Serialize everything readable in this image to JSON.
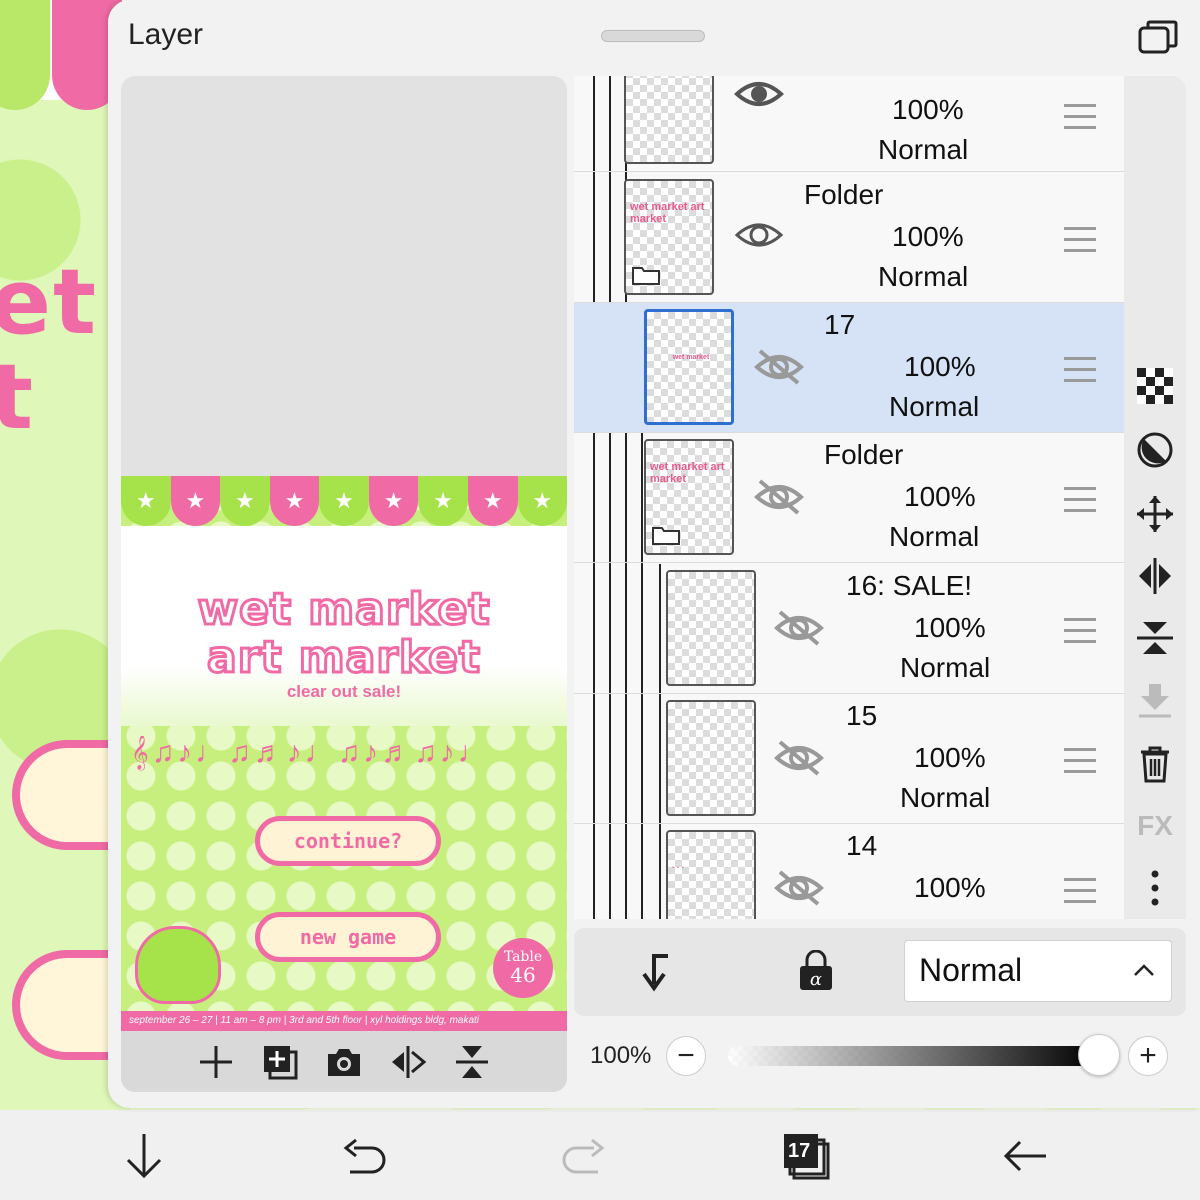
{
  "panel": {
    "title": "Layer"
  },
  "layers": [
    {
      "name": "",
      "opacity": "100%",
      "mode": "Normal",
      "visible": true,
      "type": "layer",
      "selected": false
    },
    {
      "name": "Folder",
      "opacity": "100%",
      "mode": "Normal",
      "visible": true,
      "type": "folder",
      "selected": false
    },
    {
      "name": "17",
      "opacity": "100%",
      "mode": "Normal",
      "visible": false,
      "type": "layer",
      "selected": true
    },
    {
      "name": "Folder",
      "opacity": "100%",
      "mode": "Normal",
      "visible": false,
      "type": "folder",
      "selected": false
    },
    {
      "name": "16: SALE!",
      "opacity": "100%",
      "mode": "Normal",
      "visible": false,
      "type": "layer",
      "selected": false
    },
    {
      "name": "15",
      "opacity": "100%",
      "mode": "Normal",
      "visible": false,
      "type": "layer",
      "selected": false
    },
    {
      "name": "14",
      "opacity": "100%",
      "mode": "",
      "visible": false,
      "type": "layer",
      "selected": false
    }
  ],
  "blend": {
    "mode": "Normal"
  },
  "opacity": {
    "label": "100%",
    "minus": "−",
    "plus": "+"
  },
  "tools": {
    "fx": "FX"
  },
  "bottom": {
    "layer_count": "17"
  },
  "art": {
    "title1": "wet market",
    "title2": "art market",
    "subtitle": "clear out sale!",
    "btn_continue": "continue?",
    "btn_new_game": "new game",
    "table_label": "Table",
    "table_num": "46",
    "footer": "september 26 – 27 | 11 am – 8 pm | 3rd and 5th floor | xyl holdings bldg, makati"
  },
  "colors": {
    "pink": "#f06aa5",
    "green": "#a6e34a",
    "selected_row": "#d6e3f7"
  }
}
